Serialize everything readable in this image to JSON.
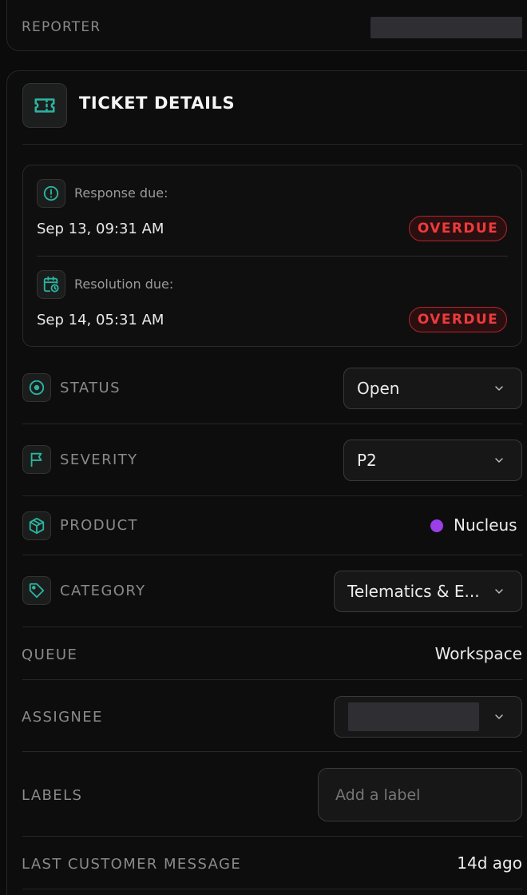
{
  "reporter": {
    "label": "REPORTER"
  },
  "ticket_details": {
    "title": "TICKET DETAILS",
    "icon": "ticket-icon",
    "accent": "#2bb5a0"
  },
  "sla": {
    "response": {
      "label": "Response due:",
      "date": "Sep 13, 09:31 AM",
      "badge": "OVERDUE",
      "icon": "alert-circle-icon"
    },
    "resolution": {
      "label": "Resolution due:",
      "date": "Sep 14, 05:31 AM",
      "badge": "OVERDUE",
      "icon": "calendar-clock-icon"
    },
    "badge_color": "#ec3b3b"
  },
  "fields": {
    "status": {
      "label": "STATUS",
      "value": "Open",
      "icon": "target-icon"
    },
    "severity": {
      "label": "SEVERITY",
      "value": "P2",
      "icon": "flag-icon"
    },
    "product": {
      "label": "PRODUCT",
      "value": "Nucleus",
      "icon": "box-icon",
      "dot_color": "#9b3fe8"
    },
    "category": {
      "label": "CATEGORY",
      "value": "Telematics & E...",
      "icon": "tag-icon"
    },
    "queue": {
      "label": "QUEUE",
      "value": "Workspace"
    },
    "assignee": {
      "label": "ASSIGNEE"
    },
    "labels": {
      "label": "LABELS",
      "placeholder": "Add a label"
    },
    "last_customer_message": {
      "label": "LAST CUSTOMER MESSAGE",
      "value": "14d ago"
    }
  }
}
